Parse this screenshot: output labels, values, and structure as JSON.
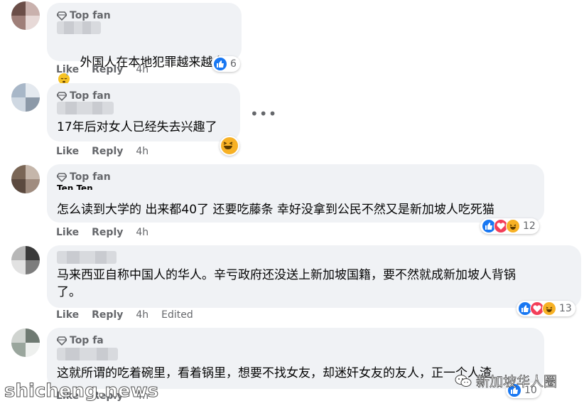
{
  "comments": [
    {
      "badge": "Top fan",
      "text": "外国人在本地犯罪越来越多",
      "actions": {
        "like": "Like",
        "reply": "Reply",
        "time": "4h"
      },
      "reaction_count": "6"
    },
    {
      "badge": "Top fan",
      "text": "17年后对女人已经失去兴趣了",
      "actions": {
        "like": "Like",
        "reply": "Reply",
        "time": "4h"
      },
      "reaction_count": ""
    },
    {
      "badge": "Top fan",
      "name_fragment": "Ten Ten",
      "text": "怎么读到大学的 出来都40了 还要吃藤条 幸好没拿到公民不然又是新加坡人吃死猫",
      "actions": {
        "like": "Like",
        "reply": "Reply",
        "time": "4h"
      },
      "reaction_count": "12"
    },
    {
      "badge": "",
      "text": "马来西亚自称中国人的华人。辛亏政府还没送上新加坡国籍，要不然就成新加坡人背锅\n了。",
      "actions": {
        "like": "Like",
        "reply": "Reply",
        "time": "4h",
        "edited": "Edited"
      },
      "reaction_count": "13"
    },
    {
      "badge": "Top fa",
      "text": "这就所谓的吃着碗里，看着锅里，想要不找女友，却迷奸女友的友人，正一个人渣",
      "actions": {
        "like": "Like",
        "reply": "Reply",
        "time": "4h"
      },
      "reaction_count": "10"
    }
  ],
  "more_menu": "•••",
  "watermarks": {
    "left": "shicheng.news",
    "right": "新加坡华人圈"
  },
  "icons": [
    "diamond-icon",
    "like-reaction-icon",
    "love-reaction-icon",
    "haha-reaction-icon",
    "wechat-icon"
  ],
  "colors": {
    "bubble": "#f0f2f5",
    "like": "#1877f2",
    "love": "#f33e58",
    "haha": "#f7b125",
    "meta": "#65676b"
  }
}
